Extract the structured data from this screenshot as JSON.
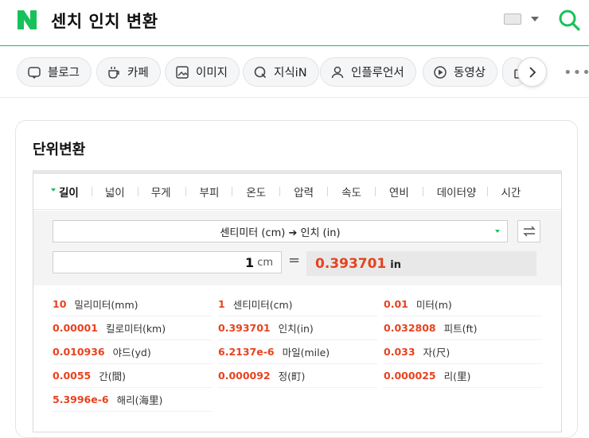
{
  "header": {
    "query": "센치 인치 변환",
    "colors": {
      "brand": "#19c15a",
      "accent": "#e8421e"
    }
  },
  "tabs": [
    {
      "label": "블로그",
      "icon": "blog-icon"
    },
    {
      "label": "카페",
      "icon": "cafe-icon"
    },
    {
      "label": "이미지",
      "icon": "image-icon"
    },
    {
      "label": "지식iN",
      "icon": "q-icon"
    },
    {
      "label": "인플루언서",
      "icon": "person-icon"
    },
    {
      "label": "동영상",
      "icon": "play-icon"
    },
    {
      "label": "",
      "icon": "bag-icon"
    }
  ],
  "converter": {
    "title": "단위변환",
    "categories": [
      "길이",
      "넓이",
      "무게",
      "부피",
      "온도",
      "압력",
      "속도",
      "연비",
      "데이터양",
      "시간"
    ],
    "selected_category": "길이",
    "unit_select": "센티미터 (cm) ➔ 인치 (in)",
    "input_value": "1",
    "input_unit": "cm",
    "equals": "=",
    "result_value": "0.393701",
    "result_unit": "in",
    "conversions": [
      {
        "value": "10",
        "unit": "밀리미터(mm)"
      },
      {
        "value": "1",
        "unit": "센티미터(cm)"
      },
      {
        "value": "0.01",
        "unit": "미터(m)"
      },
      {
        "value": "0.00001",
        "unit": "킬로미터(km)"
      },
      {
        "value": "0.393701",
        "unit": "인치(in)"
      },
      {
        "value": "0.032808",
        "unit": "피트(ft)"
      },
      {
        "value": "0.010936",
        "unit": "야드(yd)"
      },
      {
        "value": "6.2137e-6",
        "unit": "마일(mile)"
      },
      {
        "value": "0.033",
        "unit": "자(尺)"
      },
      {
        "value": "0.0055",
        "unit": "간(間)"
      },
      {
        "value": "0.000092",
        "unit": "정(町)"
      },
      {
        "value": "0.000025",
        "unit": "리(里)"
      },
      {
        "value": "5.3996e-6",
        "unit": "해리(海里)"
      }
    ]
  }
}
